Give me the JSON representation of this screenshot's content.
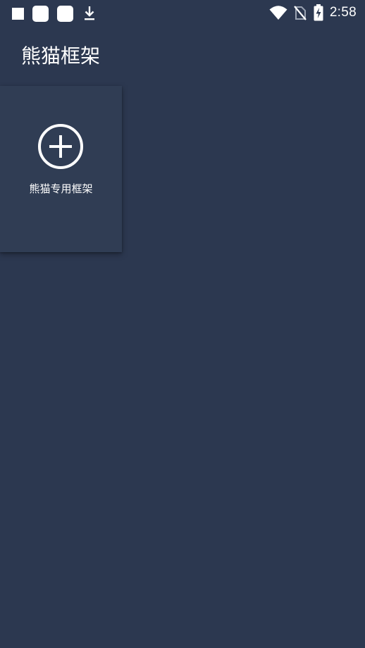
{
  "status_bar": {
    "time": "2:58",
    "left_icons": [
      "stop-notification-icon",
      "app-notification-icon",
      "app-notification-icon",
      "download-icon"
    ],
    "right_icons": [
      "wifi-icon",
      "no-sim-icon",
      "battery-charging-icon"
    ]
  },
  "header": {
    "title": "熊猫框架"
  },
  "cards": [
    {
      "label": "熊猫专用框架",
      "icon": "add-circle-icon"
    }
  ],
  "colors": {
    "background": "#2c3850",
    "card": "#303d54",
    "text": "#ffffff"
  }
}
